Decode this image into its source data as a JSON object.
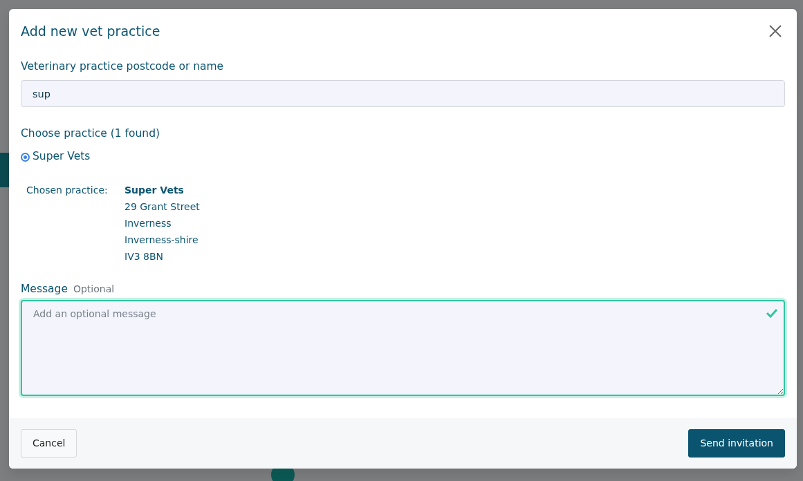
{
  "dialog": {
    "title": "Add new vet practice",
    "search": {
      "label": "Veterinary practice postcode or name",
      "value": "sup"
    },
    "results": {
      "label": "Choose practice (1 found)",
      "options": [
        {
          "name": "Super Vets",
          "selected": true
        }
      ]
    },
    "chosen": {
      "label": "Chosen practice:",
      "name": "Super Vets",
      "address": [
        "29 Grant Street",
        "Inverness",
        "Inverness-shire",
        "IV3 8BN"
      ]
    },
    "message": {
      "label": "Message",
      "hint": "Optional",
      "placeholder": "Add an optional message",
      "valid": true
    },
    "buttons": [
      {
        "label": "Cancel",
        "kind": "secondary"
      },
      {
        "label": "Send invitation",
        "kind": "primary"
      }
    ]
  }
}
